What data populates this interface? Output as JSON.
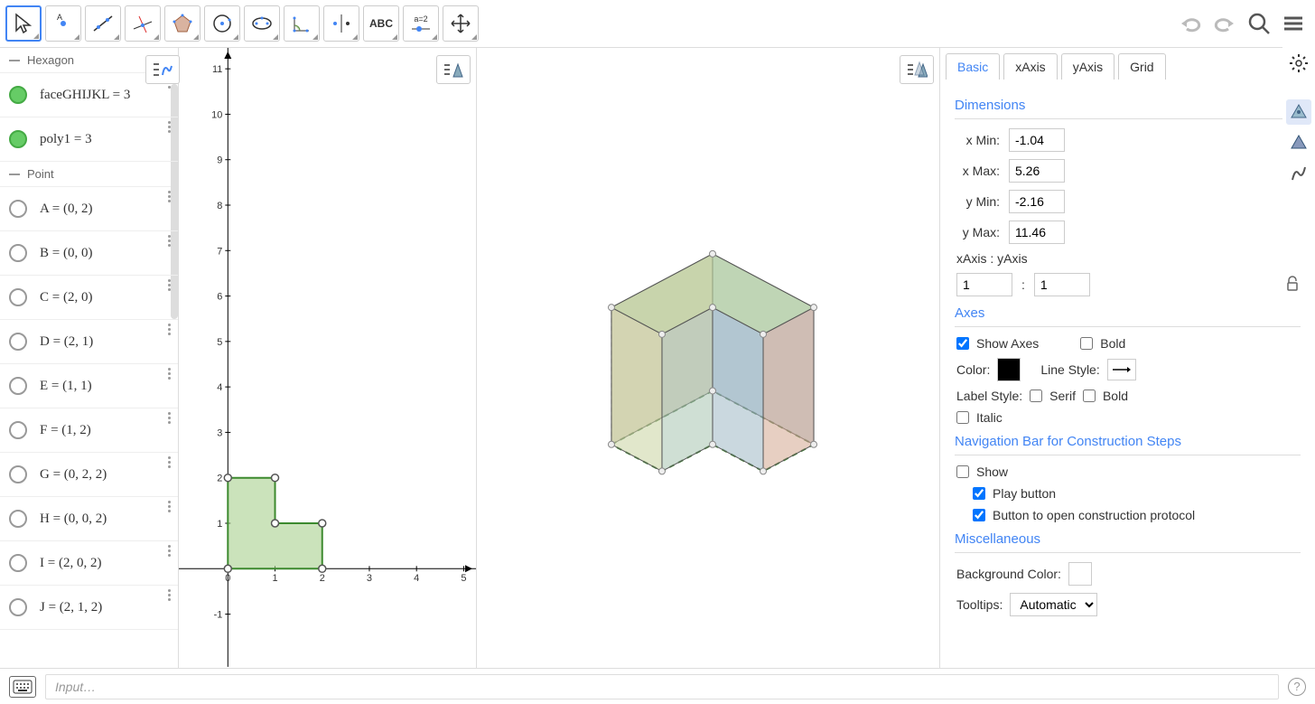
{
  "toolbar": {
    "tools": [
      {
        "name": "move-tool",
        "active": true
      },
      {
        "name": "point-tool"
      },
      {
        "name": "line-tool"
      },
      {
        "name": "perpendicular-tool"
      },
      {
        "name": "polygon-tool"
      },
      {
        "name": "circle-tool"
      },
      {
        "name": "ellipse-tool"
      },
      {
        "name": "angle-tool"
      },
      {
        "name": "reflect-tool"
      },
      {
        "name": "text-tool",
        "label": "ABC"
      },
      {
        "name": "slider-tool",
        "label": "a=2"
      },
      {
        "name": "move-graphics-tool"
      }
    ]
  },
  "algebra": {
    "groups": [
      {
        "name": "Hexagon",
        "items": [
          {
            "label": "faceGHIJKL = 3",
            "filled": true
          },
          {
            "label": "poly1 = 3",
            "filled": true
          }
        ]
      },
      {
        "name": "Point",
        "items": [
          {
            "label": "A = (0, 2)"
          },
          {
            "label": "B = (0, 0)"
          },
          {
            "label": "C = (2, 0)"
          },
          {
            "label": "D = (2, 1)"
          },
          {
            "label": "E = (1, 1)"
          },
          {
            "label": "F = (1, 2)"
          },
          {
            "label": "G = (0, 2, 2)"
          },
          {
            "label": "H = (0, 0, 2)"
          },
          {
            "label": "I = (2, 0, 2)"
          },
          {
            "label": "J = (2, 1, 2)"
          }
        ]
      }
    ]
  },
  "chart_data": {
    "type": "polygon",
    "title": "",
    "xlabel": "",
    "ylabel": "",
    "xlim": [
      -1.04,
      5.26
    ],
    "ylim": [
      -2.16,
      11.46
    ],
    "polygon2d": [
      [
        0,
        2
      ],
      [
        0,
        0
      ],
      [
        2,
        0
      ],
      [
        2,
        1
      ],
      [
        1,
        1
      ],
      [
        1,
        2
      ]
    ],
    "prism_height": 2,
    "x_ticks": [
      0,
      1,
      2,
      3,
      4,
      5
    ],
    "y_ticks": [
      -1,
      0,
      1,
      2,
      3,
      4,
      5,
      6,
      7,
      8,
      9,
      10,
      11
    ]
  },
  "properties": {
    "tabs": [
      "Basic",
      "xAxis",
      "yAxis",
      "Grid"
    ],
    "active_tab": "Basic",
    "dimensions": {
      "title": "Dimensions",
      "xmin_label": "x Min:",
      "xmin": "-1.04",
      "xmax_label": "x Max:",
      "xmax": "5.26",
      "ymin_label": "y Min:",
      "ymin": "-2.16",
      "ymax_label": "y Max:",
      "ymax": "11.46",
      "ratio_label": "xAxis : yAxis",
      "ratio_x": "1",
      "ratio_y": "1"
    },
    "axes": {
      "title": "Axes",
      "show_axes_label": "Show Axes",
      "show_axes": true,
      "bold_label": "Bold",
      "bold": false,
      "color_label": "Color:",
      "line_style_label": "Line Style:",
      "label_style_label": "Label Style:",
      "serif_label": "Serif",
      "serif": false,
      "bold2_label": "Bold",
      "bold2": false,
      "italic_label": "Italic",
      "italic": false
    },
    "navigation": {
      "title": "Navigation Bar for Construction Steps",
      "show_label": "Show",
      "show": false,
      "play_label": "Play button",
      "play": true,
      "protocol_label": "Button to open construction protocol",
      "protocol": true
    },
    "misc": {
      "title": "Miscellaneous",
      "bg_label": "Background Color:",
      "tooltips_label": "Tooltips:",
      "tooltips_value": "Automatic"
    }
  },
  "input_placeholder": "Input…"
}
